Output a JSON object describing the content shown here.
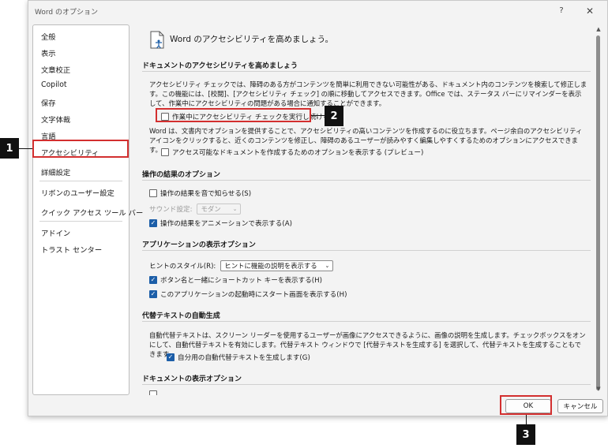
{
  "window": {
    "title": "Word のオプション",
    "help": "?",
    "close": "✕"
  },
  "sidebar": {
    "items": [
      {
        "label": "全般"
      },
      {
        "label": "表示"
      },
      {
        "label": "文章校正"
      },
      {
        "label": "Copilot"
      },
      {
        "label": "保存"
      },
      {
        "label": "文字体裁"
      },
      {
        "label": "言語"
      },
      {
        "label": "アクセシビリティ"
      },
      {
        "label": "詳細設定"
      },
      {
        "label": "リボンのユーザー設定"
      },
      {
        "label": "クイック アクセス ツール バー"
      },
      {
        "label": "アドイン"
      },
      {
        "label": "トラスト センター"
      }
    ],
    "selected": "アクセシビリティ"
  },
  "content": {
    "hero": "Word のアクセシビリティを高めましょう。",
    "doc_section": {
      "heading": "ドキュメントのアクセシビリティを高めましょう",
      "para1": "アクセシビリティ チェックでは、障碍のある方がコンテンツを簡単に利用できない可能性がある、ドキュメント内のコンテンツを検索して修正します。この機能には、[校閲]、[アクセシビリティ チェック] の順に移動してアクセスできます。Office では、ステータス バーにリマインダーを表示して、作業中にアクセシビリティの問題がある場合に通知することができます。",
      "opt_keep_checker": "作業中にアクセシビリティ チェックを実行し続ける",
      "para2": "Word は、文書内でオプションを提供することで、アクセシビリティの高いコンテンツを作成するのに役立ちます。ページ余白のアクセシビリティ アイコンをクリックすると、近くのコンテンツを修正し、障碍のあるユーザーが読みやすく編集しやすくするためのオプションにアクセスできます。",
      "opt_show_options": "アクセス可能なドキュメントを作成するためのオプションを表示する (プレビュー)"
    },
    "feedback_section": {
      "heading": "操作の結果のオプション",
      "opt_sound": "操作の結果を音で知らせる(S)",
      "sound_label": "サウンド設定:",
      "sound_value": "モダン",
      "opt_animation": "操作の結果をアニメーションで表示する(A)"
    },
    "app_section": {
      "heading": "アプリケーションの表示オプション",
      "tooltip_label": "ヒントのスタイル(R):",
      "tooltip_value": "ヒントに機能の説明を表示する",
      "opt_shortcut": "ボタン名と一緒にショートカット キーを表示する(H)",
      "opt_start": "このアプリケーションの起動時にスタート画面を表示する(H)"
    },
    "alt_section": {
      "heading": "代替テキストの自動生成",
      "para": "自動代替テキストは、スクリーン リーダーを使用するユーザーが画像にアクセスできるように、画像の説明を生成します。チェックボックスをオンにして、自動代替テキストを有効にします。代替テキスト ウィンドウで [代替テキストを生成する] を選択して、代替テキストを生成することもできます。",
      "opt_auto_alt": "自分用の自動代替テキストを生成します(G)"
    },
    "display_section": {
      "heading": "ドキュメントの表示オプション"
    }
  },
  "footer": {
    "ok": "OK",
    "cancel": "キャンセル"
  },
  "callouts": {
    "one": "1",
    "two": "2",
    "three": "3"
  },
  "colors": {
    "highlight": "#d32f2f",
    "accent": "#1c5ea8"
  }
}
